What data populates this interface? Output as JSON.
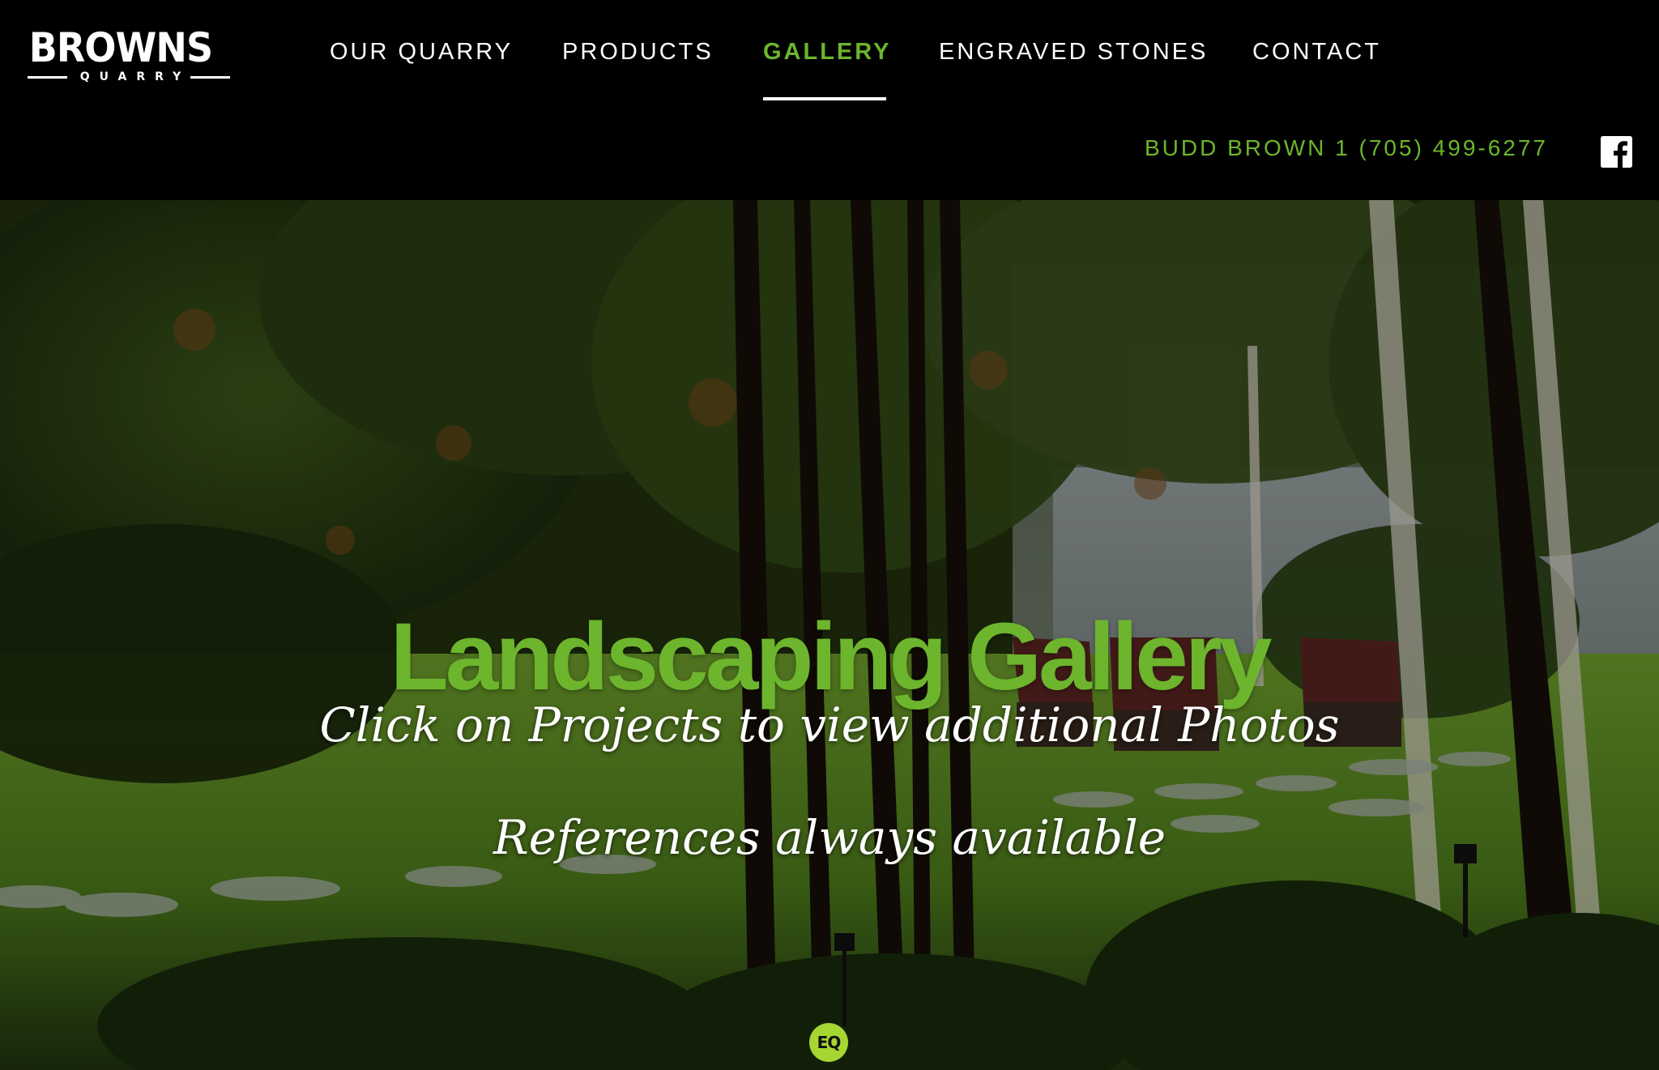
{
  "brand": {
    "name": "BROWNS",
    "sub": "QUARRY"
  },
  "nav": {
    "items": [
      {
        "label": "OUR QUARRY"
      },
      {
        "label": "PRODUCTS"
      },
      {
        "label": "GALLERY",
        "active": true
      },
      {
        "label": "ENGRAVED STONES"
      },
      {
        "label": "CONTACT"
      }
    ]
  },
  "contact": {
    "phone": "BUDD BROWN 1 (705) 499-6277"
  },
  "hero": {
    "title": "Landscaping Gallery",
    "line1": "Click on Projects to view additional Photos",
    "line2": "References always available",
    "badge": "EQ"
  },
  "colors": {
    "accent": "#6cb52d",
    "header_bg": "#000000",
    "text": "#ffffff"
  },
  "icons": {
    "social": "facebook-icon"
  }
}
